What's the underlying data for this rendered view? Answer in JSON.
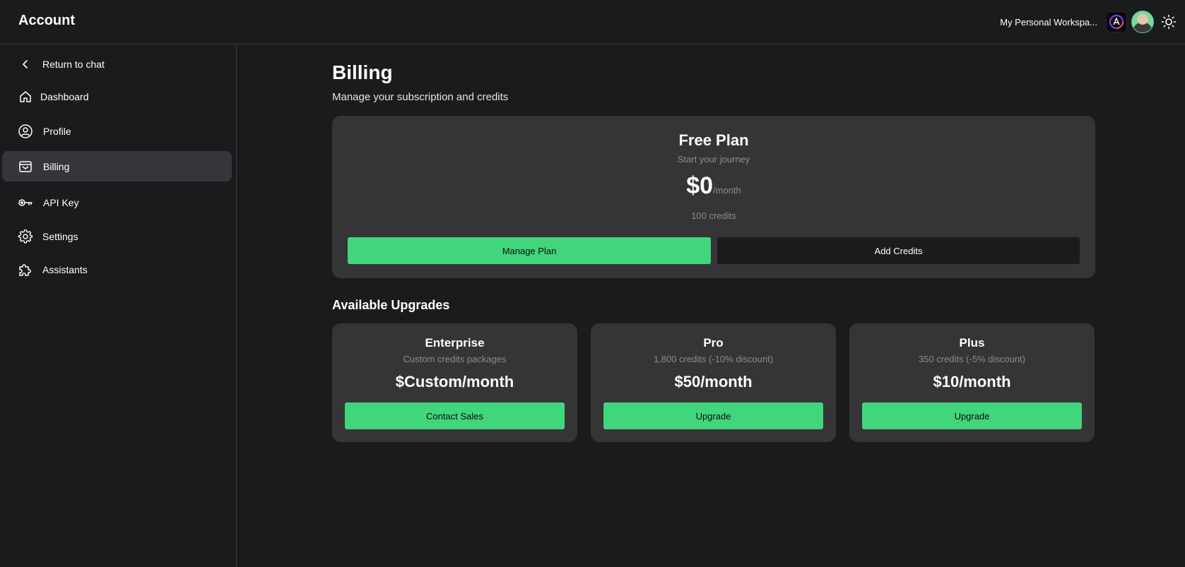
{
  "header": {
    "title": "Account",
    "workspace_name": "My Personal Workspa..."
  },
  "sidebar": {
    "items": [
      {
        "label": "Return to chat",
        "icon": "chevron-left-icon"
      },
      {
        "label": "Dashboard",
        "icon": "home-icon"
      },
      {
        "label": "Profile",
        "icon": "user-circle-icon"
      },
      {
        "label": "Billing",
        "icon": "wallet-icon",
        "active": true
      },
      {
        "label": "API Key",
        "icon": "key-icon"
      },
      {
        "label": "Settings",
        "icon": "gear-icon"
      },
      {
        "label": "Assistants",
        "icon": "puzzle-icon"
      }
    ]
  },
  "billing": {
    "title": "Billing",
    "subtitle": "Manage your subscription and credits",
    "current_plan": {
      "name": "Free Plan",
      "tagline": "Start your journey",
      "price": "$0",
      "period": "/month",
      "credits": "100 credits",
      "manage_label": "Manage Plan",
      "add_credits_label": "Add Credits"
    },
    "upgrades_title": "Available Upgrades",
    "upgrades": [
      {
        "name": "Enterprise",
        "description": "Custom credits packages",
        "price": "$Custom/month",
        "button": "Contact Sales"
      },
      {
        "name": "Pro",
        "description": "1,800 credits (-10% discount)",
        "price": "$50/month",
        "button": "Upgrade"
      },
      {
        "name": "Plus",
        "description": "350 credits (-5% discount)",
        "price": "$10/month",
        "button": "Upgrade"
      }
    ]
  },
  "colors": {
    "background": "#1a1b1d",
    "card": "#353537",
    "accent": "#42d67c",
    "muted_text": "#8c8c8e"
  }
}
